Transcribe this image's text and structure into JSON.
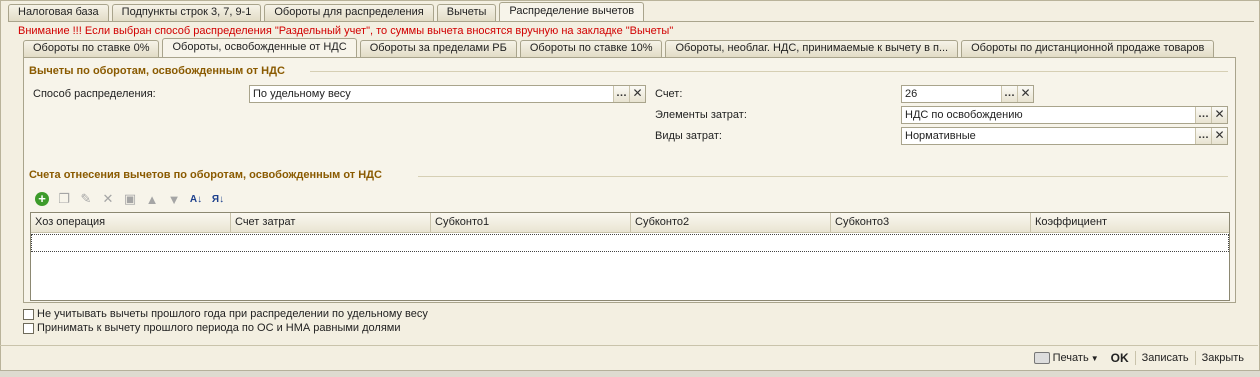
{
  "main_tabs": [
    {
      "label": "Налоговая база",
      "active": false
    },
    {
      "label": "Подпункты строк 3, 7, 9-1",
      "active": false
    },
    {
      "label": "Обороты для распределения",
      "active": false
    },
    {
      "label": "Вычеты",
      "active": false
    },
    {
      "label": "Распределение вычетов",
      "active": true
    }
  ],
  "warning": "Внимание !!! Если выбран способ распределения \"Раздельный учет\", то суммы вычета вносятся вручную на закладке \"Вычеты\"",
  "sub_tabs": [
    {
      "label": "Обороты по ставке 0%",
      "active": false
    },
    {
      "label": "Обороты, освобожденные от НДС",
      "active": true
    },
    {
      "label": "Обороты за пределами РБ",
      "active": false
    },
    {
      "label": "Обороты по ставке 10%",
      "active": false
    },
    {
      "label": "Обороты, необлаг. НДС, принимаемые к вычету в п...",
      "active": false
    },
    {
      "label": "Обороты по дистанционной продаже товаров",
      "active": false
    }
  ],
  "section1": {
    "title": "Вычеты по оборотам, освобожденным от НДС",
    "method_label": "Способ распределения:",
    "method_value": "По удельному весу",
    "account_label": "Счет:",
    "account_value": "26",
    "cost_elements_label": "Элементы затрат:",
    "cost_elements_value": "НДС по освобождению",
    "cost_types_label": "Виды затрат:",
    "cost_types_value": "Нормативные"
  },
  "section2": {
    "title": "Счета отнесения вычетов по оборотам, освобожденным от НДС"
  },
  "toolbar_icons": [
    "add-icon",
    "copy-icon",
    "edit-icon",
    "delete-icon",
    "save-icon",
    "move-up-icon",
    "move-down-icon",
    "sort-asc-icon",
    "sort-desc-icon"
  ],
  "table": {
    "columns": [
      "Хоз операция",
      "Счет затрат",
      "Субконто1",
      "Субконто2",
      "Субконто3",
      "Коэффициент"
    ]
  },
  "checkboxes": [
    {
      "label": "Не учитывать вычеты прошлого года при распределении по удельному весу",
      "checked": false
    },
    {
      "label": "Принимать к вычету прошлого периода по ОС и НМА равными долями",
      "checked": false
    }
  ],
  "footer": {
    "print": "Печать",
    "ok": "OK",
    "save": "Записать",
    "close": "Закрыть"
  },
  "colors": {
    "background": "#f3efe1",
    "warning": "#d10000",
    "section_title": "#8a5a00"
  }
}
